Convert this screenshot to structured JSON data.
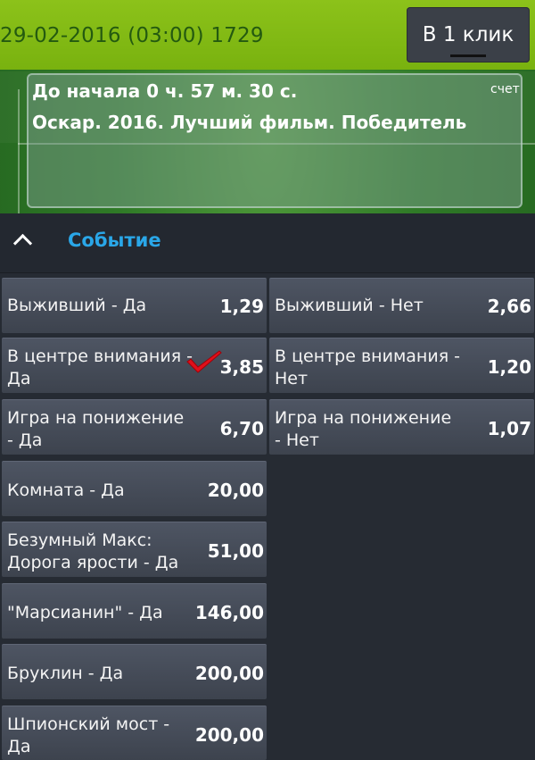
{
  "header": {
    "title": "29-02-2016 (03:00) 1729",
    "one_click_label": "В 1 клик"
  },
  "event": {
    "countdown": "До начала 0 ч. 57 м. 30 с.",
    "score_label": "счет",
    "name": "Оскар. 2016. Лучший фильм. Победитель"
  },
  "section": {
    "title": "Событие"
  },
  "outcomes": [
    {
      "line1": "Выживший - Да",
      "line2": "",
      "odd": "1,29"
    },
    {
      "line1": "Выживший - Нет",
      "line2": "",
      "odd": "2,66"
    },
    {
      "line1": "В центре внимания -",
      "line2": "Да",
      "odd": "3,85",
      "selected": true
    },
    {
      "line1": "В центре внимания -",
      "line2": "Нет",
      "odd": "1,20"
    },
    {
      "line1": "Игра на понижение",
      "line2": "- Да",
      "odd": "6,70"
    },
    {
      "line1": "Игра на понижение",
      "line2": "- Нет",
      "odd": "1,07"
    },
    {
      "line1": "Комната - Да",
      "line2": "",
      "odd": "20,00"
    },
    {
      "line1": "Безумный Макс:",
      "line2": "Дорога ярости - Да",
      "odd": "51,00"
    },
    {
      "line1": "\"Марсианин\" - Да",
      "line2": "",
      "odd": "146,00"
    },
    {
      "line1": "Бруклин - Да",
      "line2": "",
      "odd": "200,00"
    },
    {
      "line1": "Шпионский мост -",
      "line2": "Да",
      "odd": "200,00"
    }
  ],
  "colors": {
    "header_green": "#8cc21a",
    "section_title_blue": "#2aa7e8",
    "selected_check_red": "#e0101a"
  },
  "icons": {
    "collapse": "chevron-up-icon",
    "selected": "checkmark-icon"
  }
}
